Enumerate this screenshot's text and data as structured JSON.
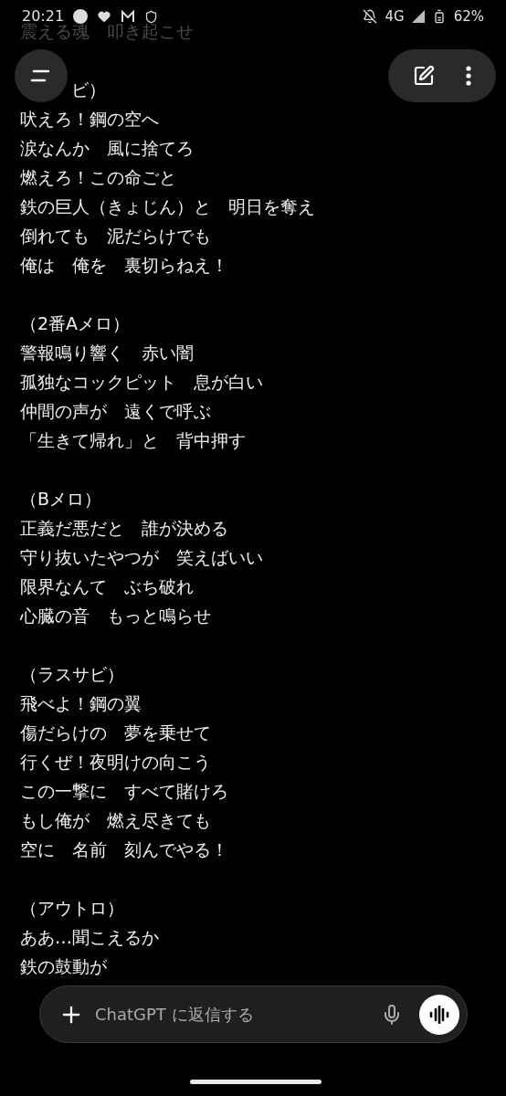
{
  "status_bar": {
    "time": "20:21",
    "network": "4G",
    "battery": "62%"
  },
  "lyrics": [
    {
      "lines": [
        {
          "text": "震える魂　叩き起こせ",
          "dimmed": true
        }
      ]
    },
    {
      "lines": [
        {
          "text": "ビ）",
          "dimmed": false
        },
        {
          "text": "吠えろ！鋼の空へ",
          "dimmed": false
        },
        {
          "text": "涙なんか　風に捨てろ",
          "dimmed": false
        },
        {
          "text": "燃えろ！この命ごと",
          "dimmed": false
        },
        {
          "text": "鉄の巨人（きょじん）と　明日を奪え",
          "dimmed": false
        },
        {
          "text": "倒れても　泥だらけでも",
          "dimmed": false
        },
        {
          "text": "俺は　俺を　裏切らねえ！",
          "dimmed": false
        }
      ]
    },
    {
      "lines": [
        {
          "text": "（2番Aメロ）",
          "dimmed": false
        },
        {
          "text": "警報鳴り響く　赤い闇",
          "dimmed": false
        },
        {
          "text": "孤独なコックピット　息が白い",
          "dimmed": false
        },
        {
          "text": "仲間の声が　遠くで呼ぶ",
          "dimmed": false
        },
        {
          "text": "「生きて帰れ」と　背中押す",
          "dimmed": false
        }
      ]
    },
    {
      "lines": [
        {
          "text": "（Bメロ）",
          "dimmed": false
        },
        {
          "text": "正義だ悪だと　誰が決める",
          "dimmed": false
        },
        {
          "text": "守り抜いたやつが　笑えばいい",
          "dimmed": false
        },
        {
          "text": "限界なんて　ぶち破れ",
          "dimmed": false
        },
        {
          "text": "心臓の音　もっと鳴らせ",
          "dimmed": false
        }
      ]
    },
    {
      "lines": [
        {
          "text": "（ラスサビ）",
          "dimmed": false
        },
        {
          "text": "飛べよ！鋼の翼",
          "dimmed": false
        },
        {
          "text": "傷だらけの　夢を乗せて",
          "dimmed": false
        },
        {
          "text": "行くぜ！夜明けの向こう",
          "dimmed": false
        },
        {
          "text": "この一撃に　すべて賭けろ",
          "dimmed": false
        },
        {
          "text": "もし俺が　燃え尽きても",
          "dimmed": false
        },
        {
          "text": "空に　名前　刻んでやる！",
          "dimmed": false
        }
      ]
    },
    {
      "lines": [
        {
          "text": "（アウトロ）",
          "dimmed": false
        },
        {
          "text": "ああ…聞こえるか",
          "dimmed": false
        },
        {
          "text": "鉄の鼓動が",
          "dimmed": false
        }
      ]
    }
  ],
  "composer": {
    "placeholder": "ChatGPT に返信する"
  }
}
